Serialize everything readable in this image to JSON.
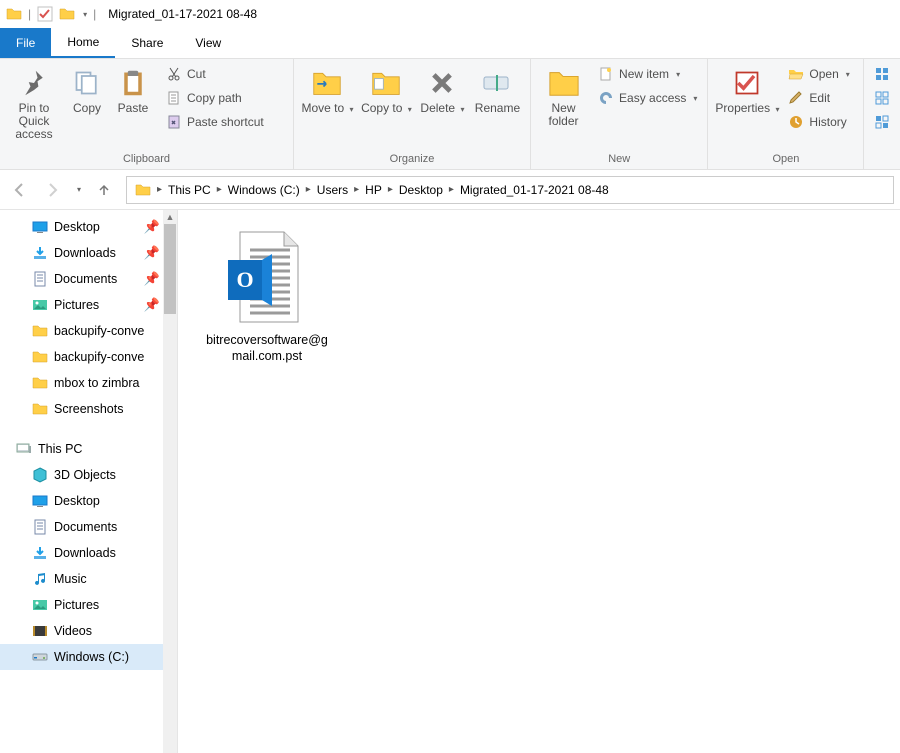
{
  "window": {
    "title": "Migrated_01-17-2021 08-48"
  },
  "tabs": {
    "file": "File",
    "home": "Home",
    "share": "Share",
    "view": "View"
  },
  "ribbon": {
    "pin_to_quick_access": "Pin to Quick access",
    "copy": "Copy",
    "paste": "Paste",
    "cut": "Cut",
    "copy_path": "Copy path",
    "paste_shortcut": "Paste shortcut",
    "group_clipboard": "Clipboard",
    "move_to": "Move to",
    "copy_to": "Copy to",
    "delete": "Delete",
    "rename": "Rename",
    "group_organize": "Organize",
    "new_folder": "New folder",
    "new_item": "New item",
    "easy_access": "Easy access",
    "group_new": "New",
    "properties": "Properties",
    "open": "Open",
    "edit": "Edit",
    "history": "History",
    "group_open_label": "Open"
  },
  "breadcrumb": [
    "This PC",
    "Windows (C:)",
    "Users",
    "HP",
    "Desktop",
    "Migrated_01-17-2021 08-48"
  ],
  "sidebar": {
    "quick": [
      {
        "label": "Desktop",
        "icon": "desktop",
        "pinned": true
      },
      {
        "label": "Downloads",
        "icon": "download",
        "pinned": true
      },
      {
        "label": "Documents",
        "icon": "document",
        "pinned": true
      },
      {
        "label": "Pictures",
        "icon": "pictures",
        "pinned": true
      },
      {
        "label": "backupify-conve",
        "icon": "folder",
        "pinned": false
      },
      {
        "label": "backupify-conve",
        "icon": "folder",
        "pinned": false
      },
      {
        "label": "mbox to zimbra",
        "icon": "folder",
        "pinned": false
      },
      {
        "label": "Screenshots",
        "icon": "folder",
        "pinned": false
      }
    ],
    "this_pc_label": "This PC",
    "this_pc": [
      {
        "label": "3D Objects",
        "icon": "3d"
      },
      {
        "label": "Desktop",
        "icon": "desktop"
      },
      {
        "label": "Documents",
        "icon": "document"
      },
      {
        "label": "Downloads",
        "icon": "download"
      },
      {
        "label": "Music",
        "icon": "music"
      },
      {
        "label": "Pictures",
        "icon": "pictures"
      },
      {
        "label": "Videos",
        "icon": "videos"
      },
      {
        "label": "Windows (C:)",
        "icon": "drive",
        "selected": true
      }
    ]
  },
  "files": [
    {
      "name": "bitrecoversoftware@gmail.com.pst",
      "icon": "pst"
    }
  ],
  "colors": {
    "accent": "#1979ca",
    "folder": "#ffcf48",
    "outlook": "#0f6cbd"
  }
}
